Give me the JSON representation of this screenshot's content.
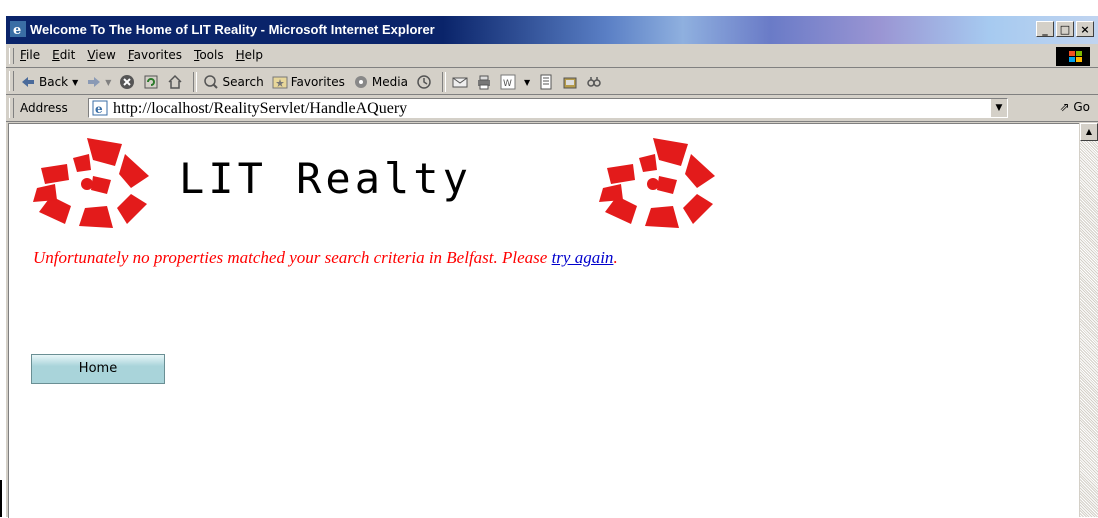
{
  "window": {
    "title": "Welcome To The Home of LIT Reality - Microsoft Internet Explorer",
    "controls": [
      "_",
      "□",
      "×"
    ]
  },
  "menubar": {
    "items": [
      "File",
      "Edit",
      "View",
      "Favorites",
      "Tools",
      "Help"
    ]
  },
  "toolbar": {
    "back_label": "Back",
    "search_label": "Search",
    "favorites_label": "Favorites",
    "media_label": "Media"
  },
  "addressbar": {
    "label": "Address",
    "url": "http://localhost/RealityServlet/HandleAQuery",
    "go_label": "Go"
  },
  "page": {
    "site_title": "LIT Realty",
    "message": "Unfortunately no properties matched your search criteria in Belfast. Please ",
    "link_text": "try again",
    "message_end": ".",
    "home_button": "Home",
    "brand_color": "#e31b1b"
  }
}
